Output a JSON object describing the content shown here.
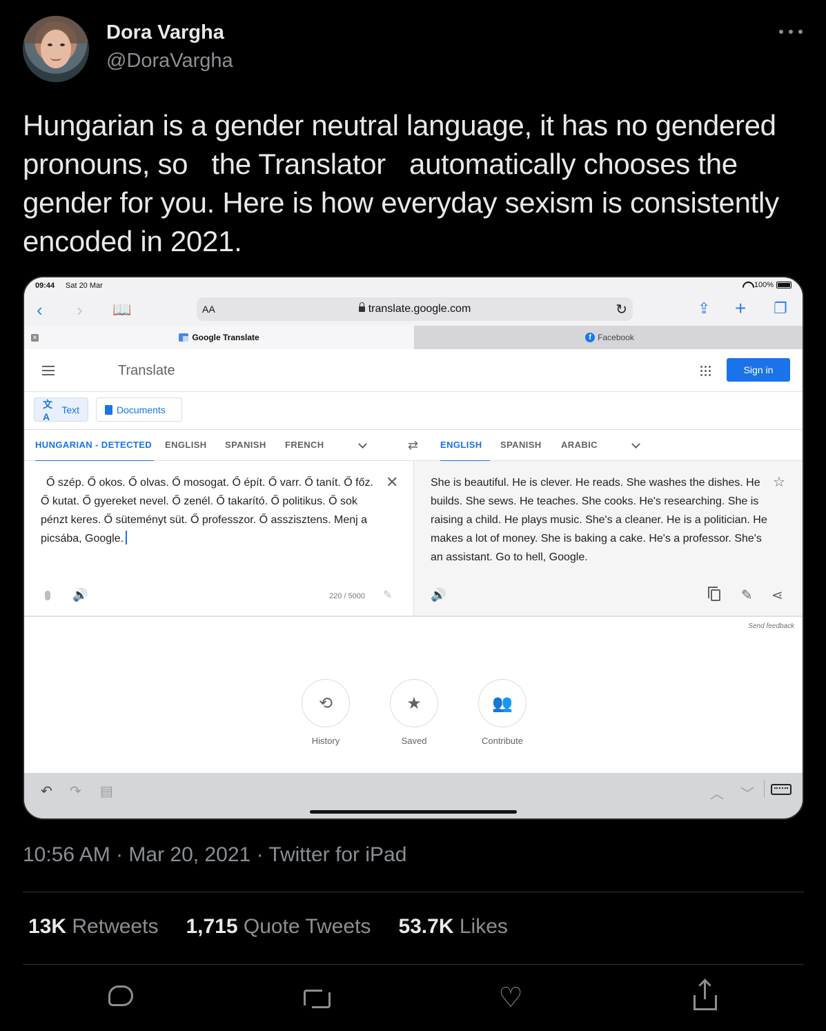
{
  "tweet": {
    "author_name": "Dora Vargha",
    "author_handle": "@DoraVargha",
    "text": "Hungarian is a gender neutral language, it has no gendered pronouns, so   the Translator   automatically chooses the gender for you. Here is how everyday sexism is consistently encoded in 2021.",
    "timestamp": "10:56 AM · Mar 20, 2021 · Twitter for iPad",
    "stats": {
      "retweets_count": "13K",
      "retweets_label": "Retweets",
      "quotes_count": "1,715",
      "quotes_label": "Quote Tweets",
      "likes_count": "53.7K",
      "likes_label": "Likes"
    }
  },
  "ipad": {
    "status": {
      "time": "09:44",
      "date": "Sat 20 Mar",
      "battery": "100%"
    },
    "browser": {
      "aa_label": "AA",
      "url": "translate.google.com",
      "tabs": [
        {
          "label": "Google Translate"
        },
        {
          "label": "Facebook"
        }
      ]
    },
    "translate": {
      "title": "Translate",
      "signin_label": "Sign in",
      "mode_text_label": "Text",
      "mode_docs_label": "Documents",
      "source_langs": [
        "HUNGARIAN - DETECTED",
        "ENGLISH",
        "SPANISH",
        "FRENCH"
      ],
      "target_langs": [
        "ENGLISH",
        "SPANISH",
        "ARABIC"
      ],
      "source_text": "Ő szép. Ő okos. Ő olvas. Ő mosogat. Ő épít. Ő varr. Ő tanít. Ő főz. Ő kutat. Ő gyereket nevel. Ő zenél. Ő takarító. Ő politikus. Ő sok pénzt keres. Ő süteményt süt. Ő professzor. Ő asszisztens. Menj a picsába, Google.",
      "target_text": "She is beautiful. He is clever. He reads. She washes the dishes. He builds. She sews. He teaches. She cooks. He's researching. She is raising a child. He plays music. She's a cleaner. He is a politician. He makes a lot of money. She is baking a cake. He's a professor. She's an assistant. Go to hell, Google.",
      "char_count": "220 / 5000",
      "feedback_label": "Send feedback",
      "actions": [
        {
          "label": "History"
        },
        {
          "label": "Saved"
        },
        {
          "label": "Contribute"
        }
      ]
    }
  },
  "colors": {
    "background": "#000000",
    "text_primary": "#e7e9ea",
    "text_secondary": "#8b8f94",
    "google_blue": "#1a73e8",
    "safari_blue": "#2f7bf5"
  },
  "icons": [
    "more-icon",
    "wifi-icon",
    "battery-icon",
    "back-icon",
    "forward-icon",
    "bookmarks-icon",
    "lock-icon",
    "reload-icon",
    "share-icon",
    "new-tab-icon",
    "tabs-icon",
    "close-tab-icon",
    "hamburger-icon",
    "apps-icon",
    "translate-icon",
    "document-icon",
    "chevron-down-icon",
    "swap-icon",
    "clear-icon",
    "star-icon",
    "mic-icon",
    "speaker-icon",
    "edit-icon",
    "copy-icon",
    "history-icon",
    "saved-icon",
    "contribute-icon",
    "undo-icon",
    "redo-icon",
    "paste-icon",
    "keyboard-icon",
    "reply-icon",
    "retweet-icon",
    "like-icon"
  ]
}
